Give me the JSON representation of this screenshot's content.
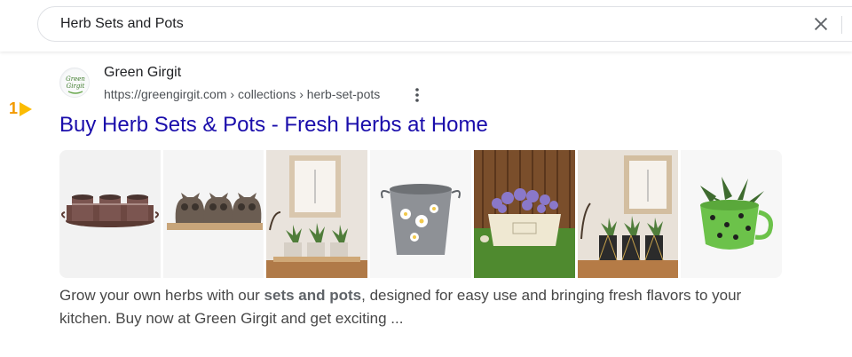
{
  "search": {
    "query": "Herb Sets and Pots"
  },
  "result": {
    "rank": "1",
    "site_name": "Green Girgit",
    "url": "https://greengirgit.com › collections › herb-set-pots",
    "title": "Buy Herb Sets & Pots - Fresh Herbs at Home",
    "snippet_before": "Grow your own herbs with our ",
    "snippet_bold": "sets and pots",
    "snippet_after": ", designed for easy use and bringing fresh flavors to your kitchen. Buy now at Green Girgit and get exciting ...",
    "favicon_text": "Green Girgit",
    "images": [
      {
        "name": "copper-tin-planter-set-image"
      },
      {
        "name": "owl-planter-set-image"
      },
      {
        "name": "succulent-trio-shelf-image"
      },
      {
        "name": "floral-tin-bucket-image"
      },
      {
        "name": "lavender-planter-image"
      },
      {
        "name": "black-pots-succulent-image"
      },
      {
        "name": "green-dotted-cup-planter-image"
      }
    ]
  },
  "colors": {
    "link": "#1a0dab",
    "rank": "#f29900",
    "rank_arrow": "#fbbc04"
  },
  "icons": {
    "clear": "close-icon",
    "more": "more-vert-icon"
  }
}
